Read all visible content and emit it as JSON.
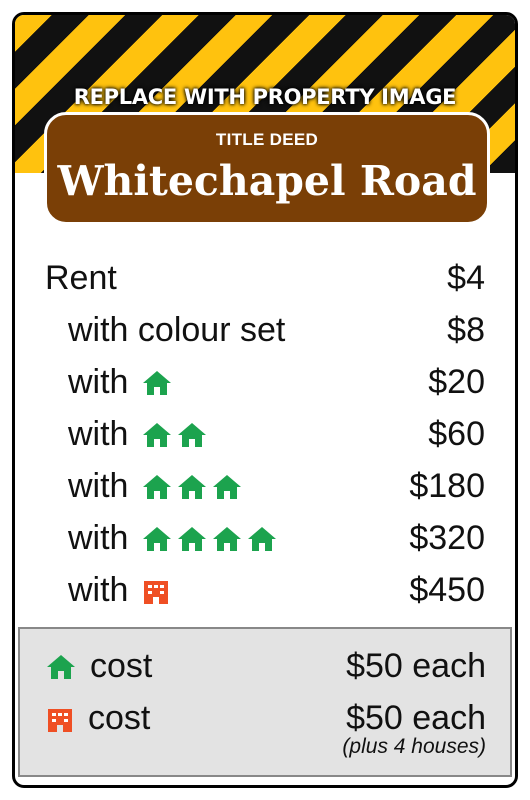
{
  "banner": {
    "text": "REPLACE WITH PROPERTY IMAGE"
  },
  "deed": {
    "label": "TITLE DEED",
    "name": "Whitechapel Road",
    "color": "#7a3f06"
  },
  "rent": [
    {
      "label": "Rent",
      "amount": "$4",
      "icon": "",
      "count": 0
    },
    {
      "label": "with colour set",
      "amount": "$8",
      "icon": "",
      "count": 0
    },
    {
      "label": "with",
      "amount": "$20",
      "icon": "house-icon",
      "count": 1
    },
    {
      "label": "with",
      "amount": "$60",
      "icon": "house-icon",
      "count": 2
    },
    {
      "label": "with",
      "amount": "$180",
      "icon": "house-icon",
      "count": 3
    },
    {
      "label": "with",
      "amount": "$320",
      "icon": "house-icon",
      "count": 4
    },
    {
      "label": "with",
      "amount": "$450",
      "icon": "hotel-icon",
      "count": 1
    }
  ],
  "costs": {
    "house": {
      "label": "cost",
      "amount": "$50 each",
      "icon": "house-icon"
    },
    "hotel": {
      "label": "cost",
      "amount": "$50 each",
      "icon": "hotel-icon",
      "note": "(plus 4 houses)"
    }
  },
  "colors": {
    "house": "#1ca34e",
    "hotel": "#ef4f24",
    "stripe_yellow": "#ffc20e",
    "stripe_black": "#111111"
  }
}
